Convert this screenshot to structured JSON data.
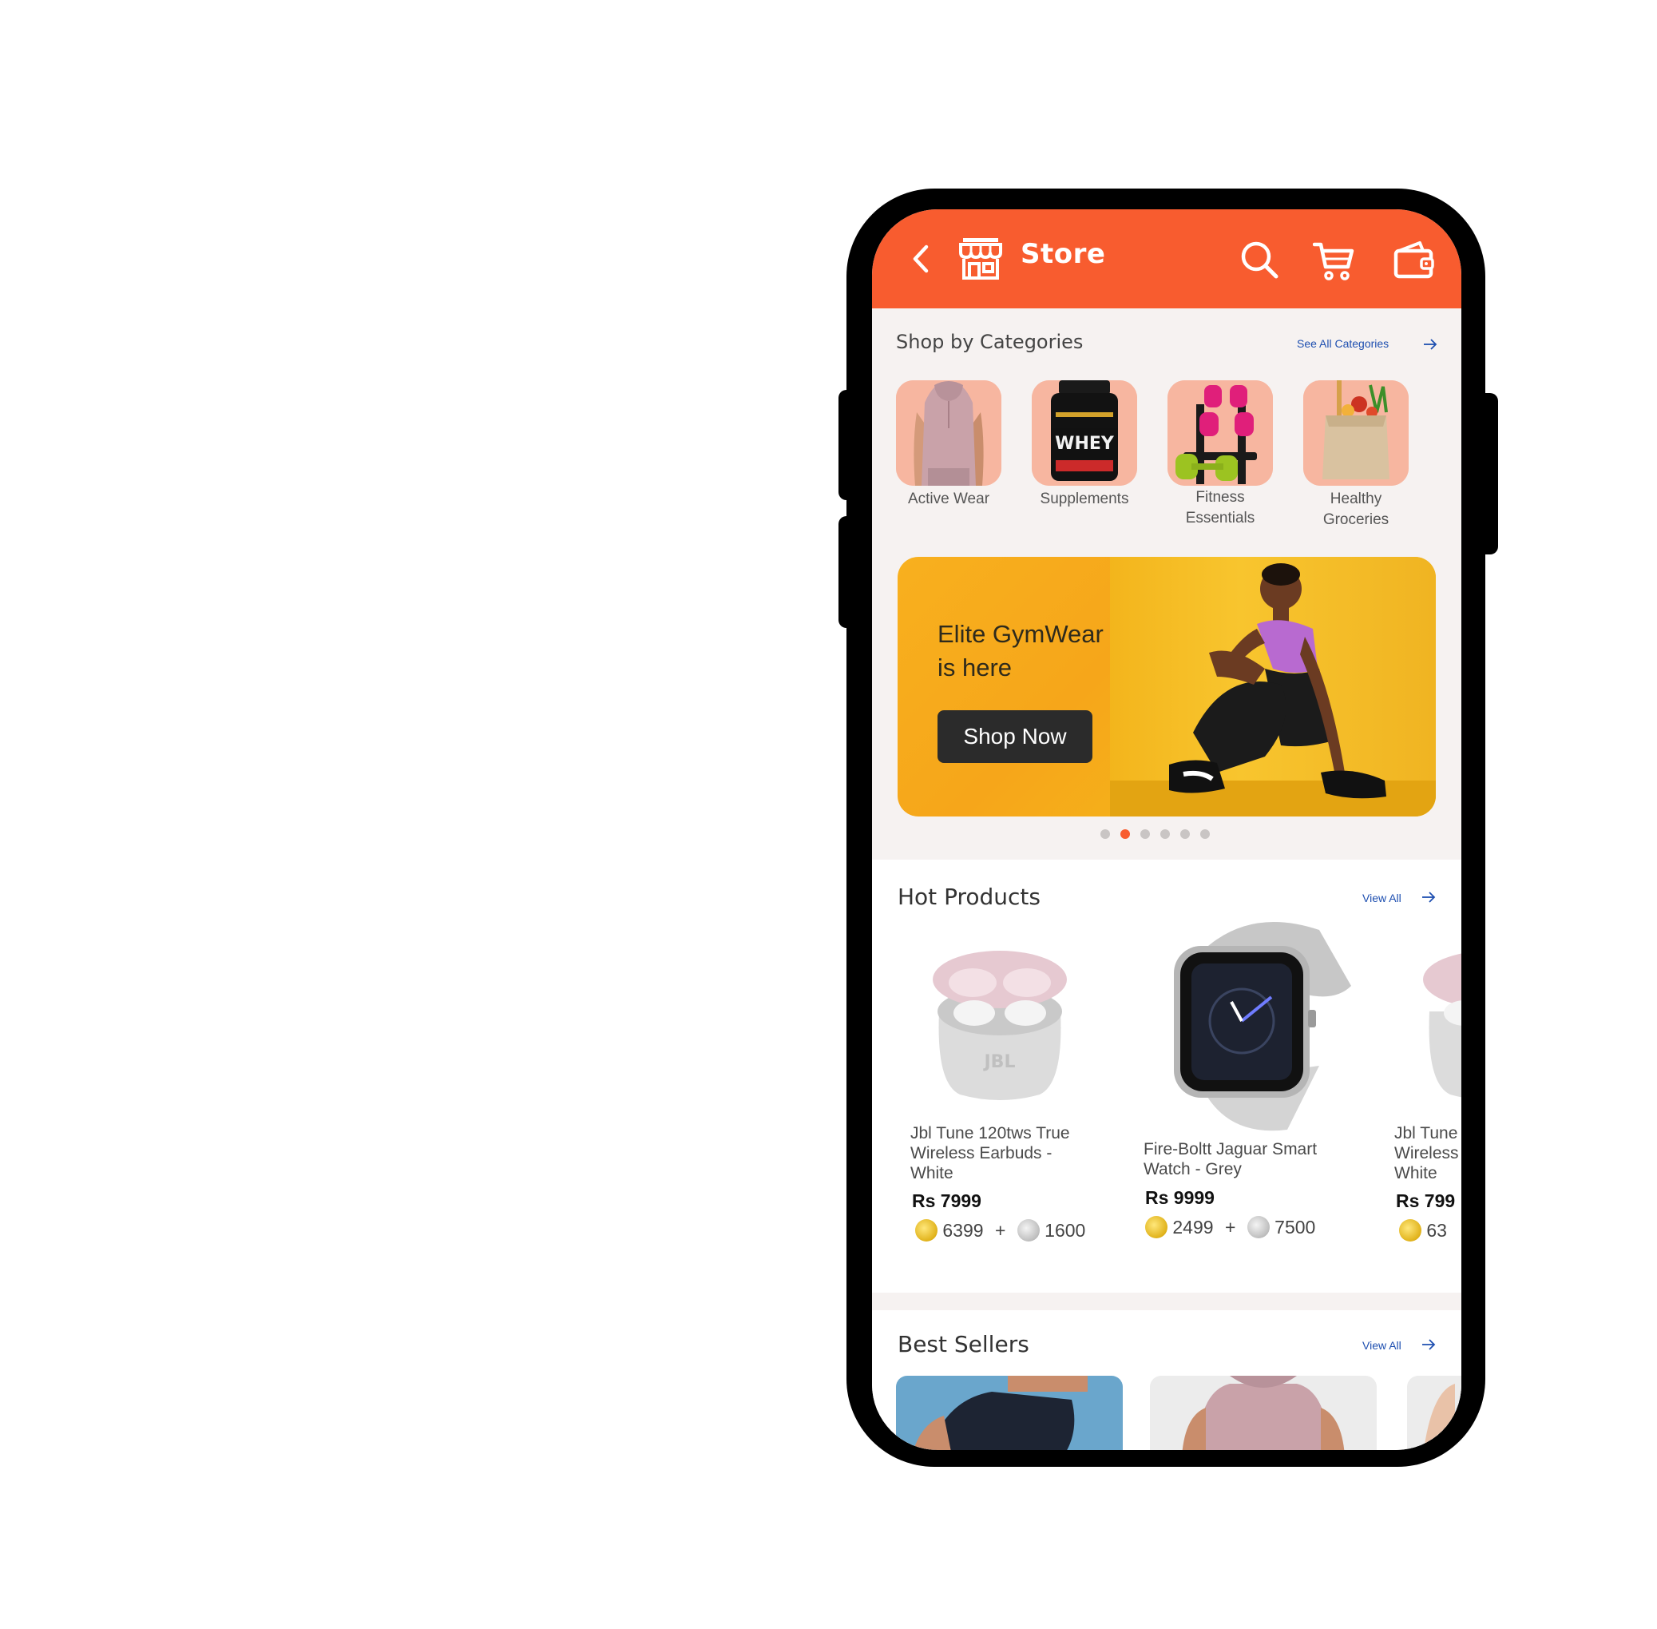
{
  "header": {
    "title": "Store",
    "back_icon": "chevron-left-icon",
    "store_icon": "storefront-icon",
    "search_icon": "search-icon",
    "cart_icon": "cart-icon",
    "wallet_icon": "wallet-icon",
    "bar_color": "#f85c2f"
  },
  "categories": {
    "title": "Shop by Categories",
    "see_all": "See All Categories",
    "items": [
      {
        "label_line1": "Active Wear",
        "label_line2": ""
      },
      {
        "label_line1": "Supplements",
        "label_line2": ""
      },
      {
        "label_line1": "Fitness",
        "label_line2": "Essentials"
      },
      {
        "label_line1": "Healthy",
        "label_line2": "Groceries"
      }
    ],
    "supplement_brand_text": "WHEY"
  },
  "banner": {
    "headline_line1": "Elite GymWear",
    "headline_line2": "is here",
    "cta": "Shop Now",
    "slide_count": 6,
    "active_slide": 2
  },
  "hot_products": {
    "title": "Hot Products",
    "view_all": "View All",
    "items": [
      {
        "name_line1": "Jbl Tune 120tws True",
        "name_line2": "Wireless Earbuds -",
        "name_line3": "White",
        "price": "Rs 7999",
        "gold": "6399",
        "plus": "+",
        "silver": "1600"
      },
      {
        "name_line1": "Fire-Boltt Jaguar Smart",
        "name_line2": "Watch - Grey",
        "name_line3": "",
        "price": "Rs 9999",
        "gold": "2499",
        "plus": "+",
        "silver": "7500"
      },
      {
        "name_line1": "Jbl Tune",
        "name_line2": "Wireless",
        "name_line3": "White",
        "price": "Rs 799",
        "gold": "63",
        "plus": "",
        "silver": ""
      }
    ],
    "earbud_brand": "JBL"
  },
  "best_sellers": {
    "title": "Best Sellers",
    "view_all": "View All"
  },
  "colors": {
    "accent": "#f85c2f",
    "link": "#1e4fb0",
    "banner": "#f6a61a"
  }
}
